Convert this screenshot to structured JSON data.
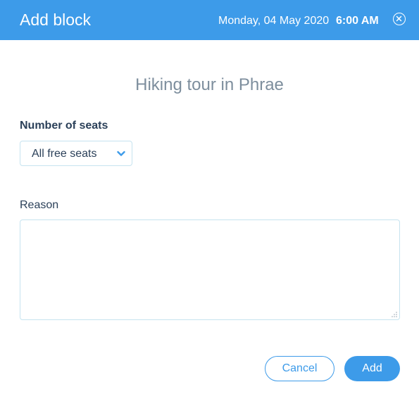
{
  "header": {
    "title": "Add block",
    "date": "Monday, 04 May 2020",
    "time": "6:00 AM",
    "close_icon": "close-icon"
  },
  "tour": {
    "title": "Hiking tour in Phrae"
  },
  "seats": {
    "label": "Number of seats",
    "selected": "All free seats",
    "icon": "chevron-down-icon"
  },
  "reason": {
    "label": "Reason",
    "value": ""
  },
  "actions": {
    "cancel_label": "Cancel",
    "add_label": "Add"
  },
  "colors": {
    "accent": "#3d9be9",
    "title_text": "#7d8e9d",
    "label_text": "#2b4059",
    "field_border": "#c6e3ef"
  }
}
